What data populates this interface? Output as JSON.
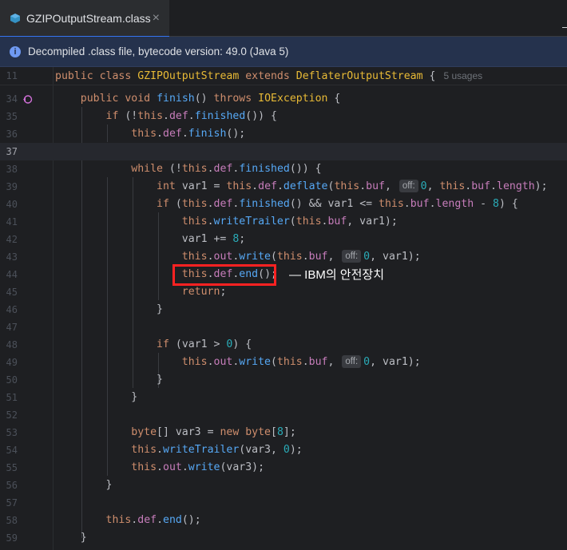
{
  "tab": {
    "title": "GZIPOutputStream.class",
    "close_glyph": "×",
    "icon": "class-file-icon"
  },
  "banner": {
    "text": "Decompiled .class file, bytecode version: 49.0 (Java 5)",
    "icon": "info-icon"
  },
  "class_line": {
    "number": "11",
    "usages": "5 usages"
  },
  "line_numbers": [
    "34",
    "35",
    "36",
    "37",
    "38",
    "39",
    "40",
    "41",
    "42",
    "43",
    "44",
    "45",
    "46",
    "47",
    "48",
    "49",
    "50",
    "51",
    "52",
    "53",
    "54",
    "55",
    "56",
    "57",
    "58",
    "59"
  ],
  "current_line": "37",
  "param_hint": "off:",
  "annotation": "— IBM의 안전장치",
  "colors": {
    "keyword": "#cf8e6d",
    "class_name": "#e8ba36",
    "field": "#c77dbb",
    "method": "#56a8f5",
    "number": "#2aacb8",
    "highlight_box": "#ff2222"
  }
}
